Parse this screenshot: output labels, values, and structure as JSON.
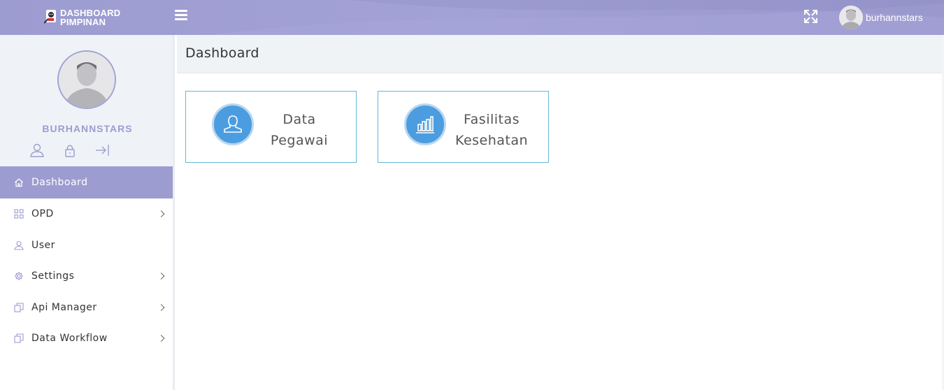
{
  "app": {
    "logo_line1": "DASHBOARD",
    "logo_line2": "PIMPINAN",
    "brand_color": "#9D9CD1",
    "accent_color": "#4B9DDF"
  },
  "topbar": {
    "menu_icon": "hamburger-icon",
    "fullscreen_icon": "expand-icon",
    "username": "burhannstars"
  },
  "sidebar": {
    "profile_name": "BURHANNSTARS",
    "profile_actions": [
      "user-icon",
      "lock-icon",
      "logout-icon"
    ],
    "items": [
      {
        "label": "Dashboard",
        "icon": "home-icon",
        "active": true,
        "has_children": false
      },
      {
        "label": "OPD",
        "icon": "grid-icon",
        "active": false,
        "has_children": true
      },
      {
        "label": "User",
        "icon": "user-icon",
        "active": false,
        "has_children": false
      },
      {
        "label": "Settings",
        "icon": "gear-icon",
        "active": false,
        "has_children": true
      },
      {
        "label": "Api Manager",
        "icon": "documents-icon",
        "active": false,
        "has_children": true
      },
      {
        "label": "Data Workflow",
        "icon": "documents-icon",
        "active": false,
        "has_children": true
      }
    ]
  },
  "main": {
    "page_title": "Dashboard",
    "cards": [
      {
        "line1": "Data",
        "line2": "Pegawai",
        "icon": "user-icon"
      },
      {
        "line1": "Fasilitas",
        "line2": "Kesehatan",
        "icon": "bar-chart-icon"
      }
    ]
  }
}
